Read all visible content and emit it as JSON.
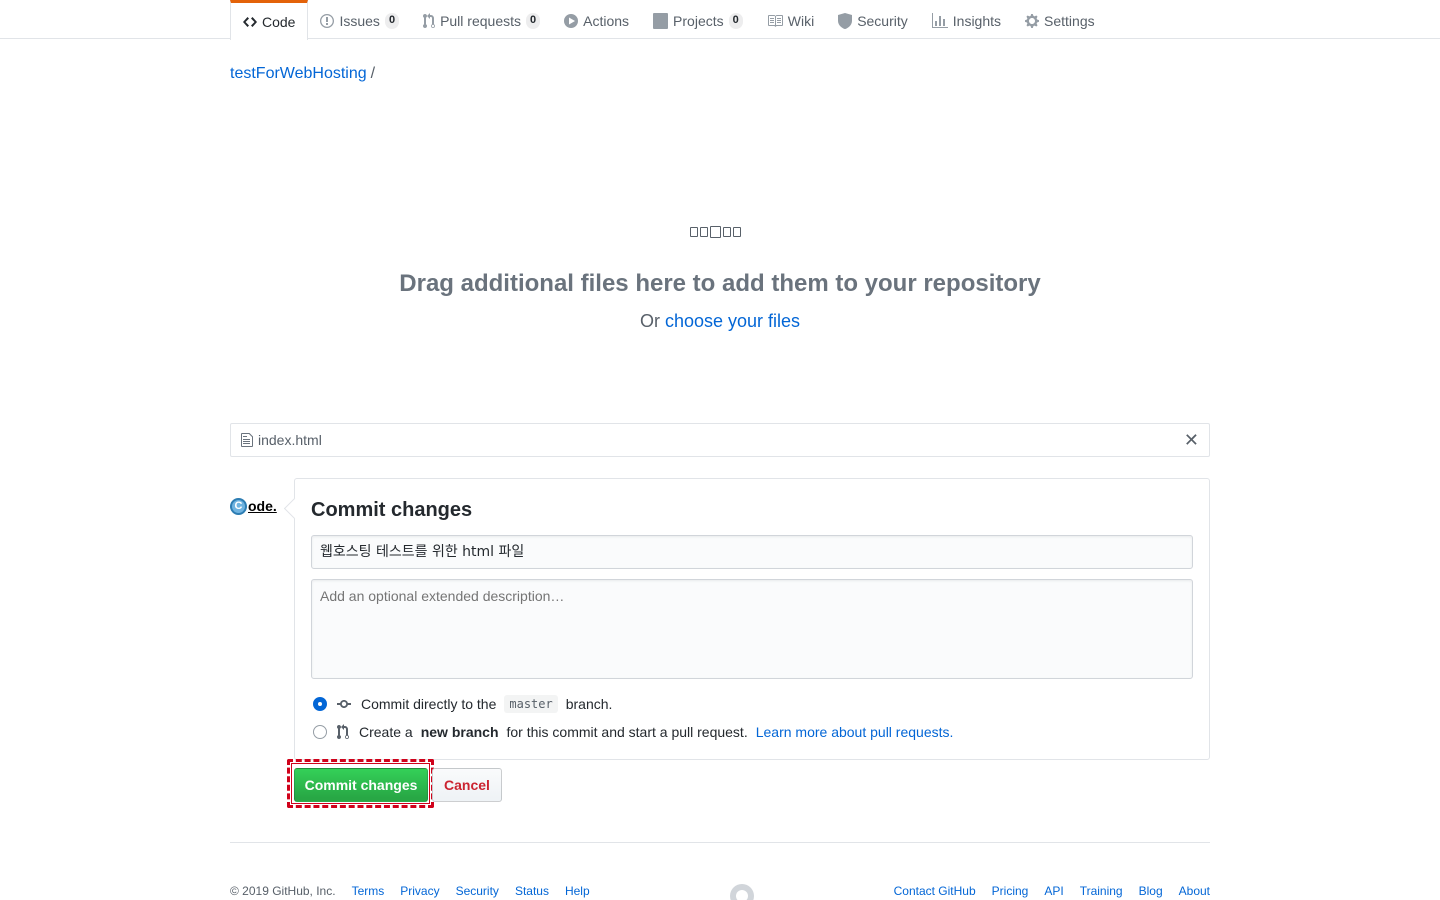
{
  "nav": {
    "code": "Code",
    "issues": "Issues",
    "issues_count": "0",
    "pulls": "Pull requests",
    "pulls_count": "0",
    "actions": "Actions",
    "projects": "Projects",
    "projects_count": "0",
    "wiki": "Wiki",
    "security": "Security",
    "insights": "Insights",
    "settings": "Settings",
    "selected_tab": "Code",
    "accent_color": "#e36209"
  },
  "breadcrumb": {
    "repo": "testForWebHosting",
    "separator": "/"
  },
  "dropzone": {
    "title": "Drag additional files here to add them to your repository",
    "or_text": "Or",
    "choose_link": "choose your files"
  },
  "file": {
    "name": "index.html",
    "remove_icon": "x-icon"
  },
  "avatar": {
    "letter": "C",
    "text": "ode."
  },
  "commit": {
    "title": "Commit changes",
    "summary_value": "웹호스팅 테스트를 위한 html 파일",
    "description_placeholder": "Add an optional extended description…",
    "option1_prefix": "Commit directly to the",
    "option1_branch": "master",
    "option1_suffix": "branch.",
    "option1_checked": true,
    "option2_prefix": "Create a",
    "option2_bold": "new branch",
    "option2_suffix": "for this commit and start a pull request.",
    "option2_link": "Learn more about pull requests.",
    "option2_checked": false
  },
  "buttons": {
    "commit": "Commit changes",
    "cancel": "Cancel",
    "commit_color": "#28a745",
    "cancel_text_color": "#cb2431",
    "highlight_color": "#d0021b"
  },
  "footer": {
    "copyright": "© 2019 GitHub, Inc.",
    "left_links": [
      "Terms",
      "Privacy",
      "Security",
      "Status",
      "Help"
    ],
    "right_links": [
      "Contact GitHub",
      "Pricing",
      "API",
      "Training",
      "Blog",
      "About"
    ]
  }
}
